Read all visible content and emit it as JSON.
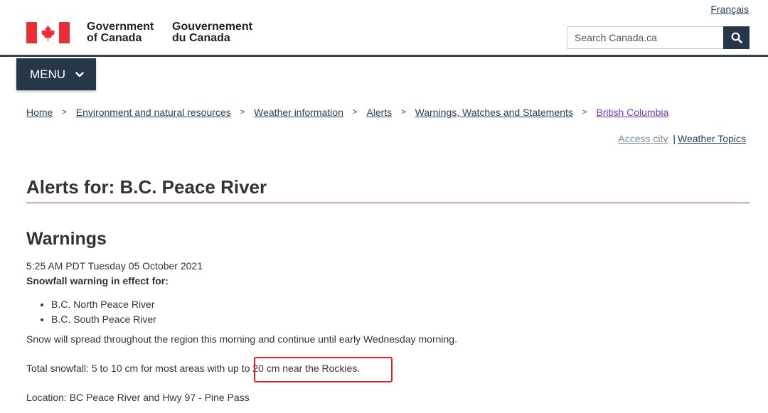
{
  "header": {
    "language_link": "Français",
    "signature_en": [
      "Government",
      "of Canada"
    ],
    "signature_fr": [
      "Gouvernement",
      "du Canada"
    ],
    "search": {
      "placeholder": "Search Canada.ca",
      "button_icon": "search-icon"
    },
    "menu_label": "MENU",
    "menu_icon": "chevron-down-icon",
    "brand_color": "#26374a",
    "flag_color": "#eb2d37"
  },
  "breadcrumb": [
    {
      "label": "Home"
    },
    {
      "label": "Environment and natural resources"
    },
    {
      "label": "Weather information"
    },
    {
      "label": "Alerts"
    },
    {
      "label": "Warnings, Watches and Statements"
    },
    {
      "label": "British Columbia"
    }
  ],
  "breadcrumb_separator": ">",
  "aux_links": {
    "access_city": "Access city",
    "separator": "|",
    "weather_topics": "Weather Topics"
  },
  "page": {
    "title": "Alerts for: B.C. Peace River",
    "section_title": "Warnings",
    "timestamp": "5:25 AM PDT Tuesday 05 October 2021",
    "warning_heading": "Snowfall warning in effect for:",
    "regions": [
      "B.C. North Peace River",
      "B.C. South Peace River"
    ],
    "paragraphs": [
      "Snow will spread throughout the region this morning and continue until early Wednesday morning.",
      "Total snowfall: 5 to 10 cm for most areas with up to 20 cm near the Rockies.",
      "Location: BC Peace River and Hwy 97 - Pine Pass"
    ]
  },
  "annotation": {
    "highlighted_text": "20 cm near the Rockies.",
    "color": "#e02020"
  }
}
